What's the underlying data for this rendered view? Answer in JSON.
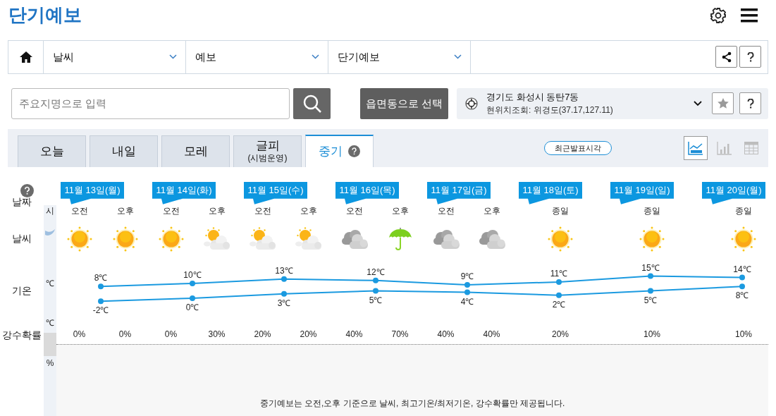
{
  "title": "단기예보",
  "nav": {
    "items": [
      "날씨",
      "예보",
      "단기예보"
    ]
  },
  "search": {
    "placeholder": "주요지명으로 입력"
  },
  "area_button": "읍면동으로 선택",
  "location": {
    "name": "경기도 화성시 동탄7동",
    "detail": "현위치조회: 위경도(37.17,127.11)"
  },
  "tabs": [
    {
      "label": "오늘",
      "selected": false
    },
    {
      "label": "내일",
      "selected": false
    },
    {
      "label": "모레",
      "selected": false
    },
    {
      "label": "글피",
      "sublabel": "(시범운영)",
      "selected": false
    },
    {
      "label": "중기",
      "selected": true,
      "help": true
    }
  ],
  "latest_button": "최근발표시각",
  "view_modes": [
    {
      "kind": "line",
      "selected": true
    },
    {
      "kind": "bar",
      "selected": false
    },
    {
      "kind": "table",
      "selected": false
    }
  ],
  "row_labels": [
    "날짜",
    "날씨",
    "기온",
    "강수확률"
  ],
  "prev_column": {
    "period": "시",
    "temp": "℃",
    "pop": "℃",
    "extra": "%"
  },
  "days": [
    {
      "periods": [
        {
          "label": "오전",
          "kind": "sun",
          "pop": "0%"
        },
        {
          "label": "오후",
          "kind": "sun",
          "pop": "0%"
        }
      ]
    },
    {
      "periods": [
        {
          "label": "오전",
          "kind": "sun",
          "pop": "0%"
        },
        {
          "label": "오후",
          "kind": "partly_cloudy",
          "pop": "30%"
        }
      ]
    },
    {
      "periods": [
        {
          "label": "오전",
          "kind": "partly_cloudy",
          "pop": "20%"
        },
        {
          "label": "오후",
          "kind": "partly_cloudy",
          "pop": "20%"
        }
      ]
    },
    {
      "periods": [
        {
          "label": "오전",
          "kind": "cloudy",
          "pop": "40%"
        },
        {
          "label": "오후",
          "kind": "rain",
          "pop": "70%"
        }
      ]
    },
    {
      "periods": [
        {
          "label": "오전",
          "kind": "cloudy",
          "pop": "40%"
        },
        {
          "label": "오후",
          "kind": "cloudy",
          "pop": "40%"
        }
      ]
    },
    {
      "periods": [
        {
          "label": "종일",
          "kind": "sun",
          "pop": "20%"
        }
      ]
    },
    {
      "periods": [
        {
          "label": "종일",
          "kind": "sun",
          "pop": "10%"
        }
      ]
    },
    {
      "periods": [
        {
          "label": "종일",
          "kind": "sun",
          "pop": "10%"
        }
      ]
    }
  ],
  "chart_data": {
    "type": "line",
    "categories": [
      "11월 13일(월)",
      "11월 14일(화)",
      "11월 15일(수)",
      "11월 16일(목)",
      "11월 17일(금)",
      "11월 18일(토)",
      "11월 19일(일)",
      "11월 20일(월)"
    ],
    "data_labels": true,
    "series": [
      {
        "color": "#1b9ae0",
        "marker": "circle",
        "values": [
          8,
          10,
          13,
          12,
          9,
          11,
          15,
          14
        ],
        "value_labels": [
          "8℃",
          "10℃",
          "13℃",
          "12℃",
          "9℃",
          "11℃",
          "15℃",
          "14℃"
        ]
      },
      {
        "color": "#1b9ae0",
        "marker": "circle",
        "values": [
          -2,
          0,
          3,
          5,
          4,
          2,
          5,
          8
        ],
        "value_labels": [
          "-2℃",
          "0℃",
          "3℃",
          "5℃",
          "4℃",
          "2℃",
          "5℃",
          "8℃"
        ]
      }
    ]
  },
  "note": "중기예보는 오전,오후 기준으로 날씨, 최고기온/최저기온, 강수확률만 제공됩니다."
}
